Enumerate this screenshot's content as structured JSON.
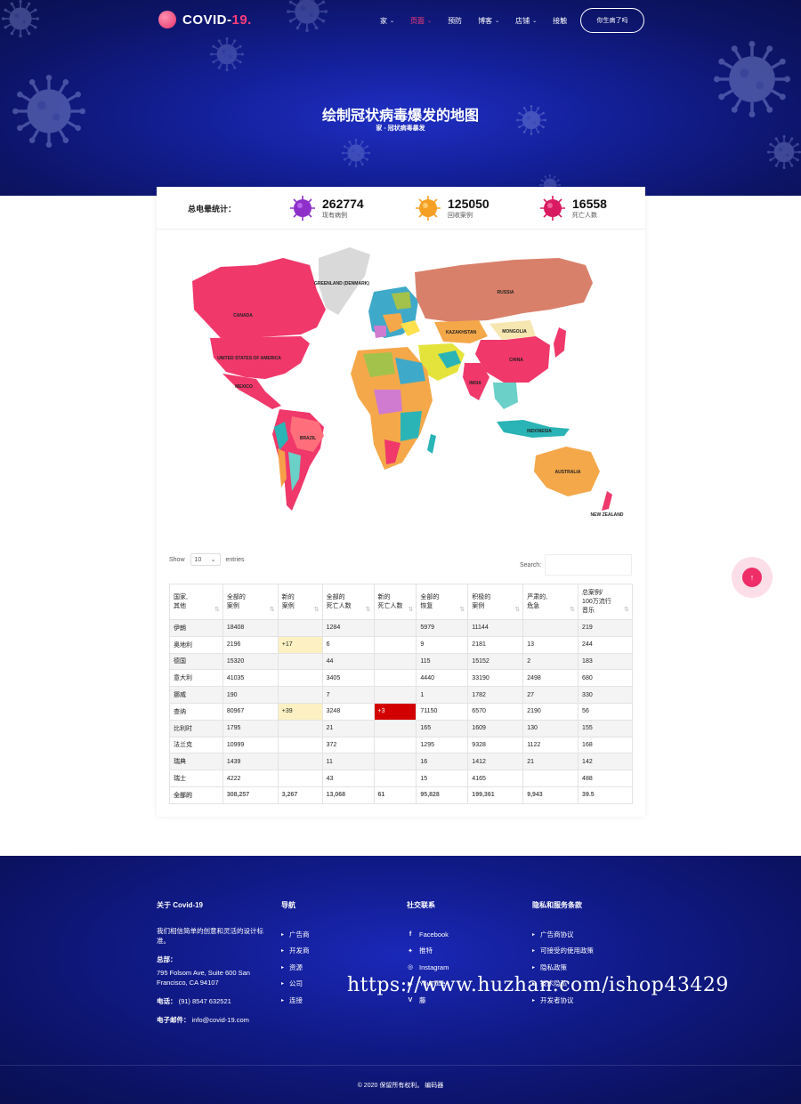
{
  "nav": {
    "brand": "COVID-",
    "brand_accent": "19.",
    "items": [
      {
        "label": "家",
        "has_caret": true,
        "active": false
      },
      {
        "label": "页面",
        "has_caret": true,
        "active": true
      },
      {
        "label": "预防",
        "has_caret": false,
        "active": false
      },
      {
        "label": "博客",
        "has_caret": true,
        "active": false
      },
      {
        "label": "店铺",
        "has_caret": true,
        "active": false
      },
      {
        "label": "接触",
        "has_caret": false,
        "active": false
      }
    ],
    "cta_label": "你生病了吗"
  },
  "hero": {
    "title": "绘制冠状病毒爆发的地图",
    "breadcrumb": "家 - 冠状病毒暴发"
  },
  "stats": {
    "label": "总电晕统计：",
    "items": [
      {
        "value": "262774",
        "label": "现有病例",
        "color": "#8e2fc9"
      },
      {
        "value": "125050",
        "label": "回收案例",
        "color": "#f5a023"
      },
      {
        "value": "16558",
        "label": "死亡人数",
        "color": "#d81b60"
      }
    ]
  },
  "map": {
    "labels": {
      "canada": "CANADA",
      "usa": "UNITED STATES OF AMERICA",
      "mexico": "MEXICO",
      "greenland": "GREENLAND (DENMARK)",
      "brazil": "BRAZIL",
      "russia": "RUSSIA",
      "kazakhstan": "KAZAKHSTAN",
      "mongolia": "MONGOLIA",
      "china": "CHINA",
      "india": "INDIA",
      "indonesia": "INDONESIA",
      "australia": "AUSTRALIA",
      "nz": "NEW ZEALAND"
    }
  },
  "datatable": {
    "show_label": "Show",
    "page_size": "10",
    "entries_label": "entries",
    "search_label": "Search:",
    "columns": [
      [
        "国家,",
        "其他"
      ],
      [
        "全部的",
        "案例"
      ],
      [
        "新的",
        "案例"
      ],
      [
        "全部的",
        "死亡人数"
      ],
      [
        "新的",
        "死亡人数"
      ],
      [
        "全部的",
        "恢复"
      ],
      [
        "积极的",
        "案例"
      ],
      [
        "严肃的,",
        "危急"
      ],
      [
        "总案例/",
        "100万流行",
        "音乐"
      ]
    ],
    "rows": [
      [
        "伊朗",
        "18408",
        "",
        "1284",
        "",
        "5979",
        "11144",
        "",
        "219"
      ],
      [
        "奥地利",
        "2196",
        "+17",
        "6",
        "",
        "9",
        "2181",
        "13",
        "244"
      ],
      [
        "德国",
        "15320",
        "",
        "44",
        "",
        "115",
        "15152",
        "2",
        "183"
      ],
      [
        "意大利",
        "41035",
        "",
        "3405",
        "",
        "4440",
        "33190",
        "2498",
        "680"
      ],
      [
        "挪威",
        "190",
        "",
        "7",
        "",
        "1",
        "1782",
        "27",
        "330"
      ],
      [
        "查纳",
        "80967",
        "+39",
        "3248",
        "+3",
        "71150",
        "6570",
        "2190",
        "56"
      ],
      [
        "比利时",
        "1795",
        "",
        "21",
        "",
        "165",
        "1609",
        "130",
        "155"
      ],
      [
        "法兰克",
        "10999",
        "",
        "372",
        "",
        "1295",
        "9328",
        "1122",
        "168"
      ],
      [
        "瑞典",
        "1439",
        "",
        "11",
        "",
        "16",
        "1412",
        "21",
        "142"
      ],
      [
        "瑞士",
        "4222",
        "",
        "43",
        "",
        "15",
        "4165",
        "",
        "488"
      ]
    ],
    "totals": [
      "全部的",
      "308,257",
      "3,267",
      "13,068",
      "61",
      "95,828",
      "199,361",
      "9,943",
      "39.5"
    ],
    "highlight_new_cases": "#fdf1c3",
    "highlight_new_deaths": "#d30000"
  },
  "footer": {
    "about": {
      "title": "关于 Covid-19",
      "desc": "我们相信简单的创意和灵活的设计标准。",
      "hq_label": "总部：",
      "address": "795 Folsom Ave, Suite 600 San Francisco, CA 94107",
      "phone_label": "电话：",
      "phone": "(91) 8547 632521",
      "email_label": "电子邮件：",
      "email": "info@covid-19.com"
    },
    "nav": {
      "title": "导航",
      "items": [
        "广告商",
        "开发商",
        "资源",
        "公司",
        "连接"
      ]
    },
    "social": {
      "title": "社交联系",
      "items": [
        {
          "icon": "facebook-icon",
          "label": "Facebook"
        },
        {
          "icon": "twitter-icon",
          "label": "推特"
        },
        {
          "icon": "instagram-icon",
          "label": "Instagram"
        },
        {
          "icon": "youtube-icon",
          "label": "YouTube"
        },
        {
          "icon": "vine-icon",
          "label": "藤"
        }
      ]
    },
    "terms": {
      "title": "隐私和服务条款",
      "items": [
        "广告商协议",
        "可接受的使用政策",
        "隐私政策",
        "技术隐私",
        "开发者协议"
      ]
    },
    "watermark": "https://www.huzhan.com/ishop43429",
    "copyright": "© 2020 保留所有权利。 编码器"
  }
}
